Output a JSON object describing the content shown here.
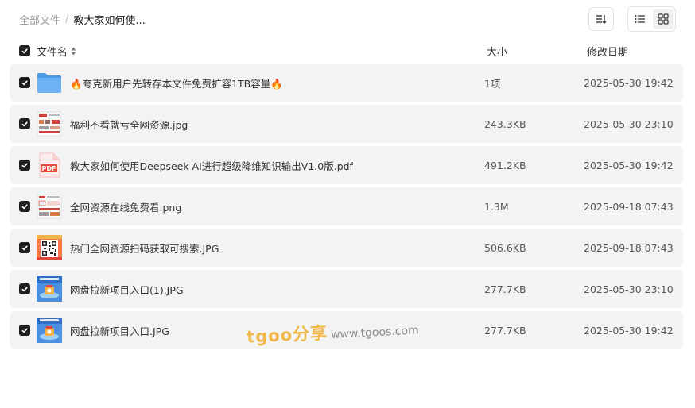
{
  "breadcrumb": {
    "root": "全部文件",
    "separator": "/",
    "current": "教大家如何使..."
  },
  "toolbar": {
    "sort_icon": "sort-icon",
    "list_view_icon": "list-view-icon",
    "grid_view_icon": "grid-view-icon",
    "active_view": "list"
  },
  "table": {
    "headers": {
      "name": "文件名",
      "size": "大小",
      "date": "修改日期"
    },
    "all_checked": true,
    "rows": [
      {
        "name": "🔥夸克新用户先转存本文件免费扩容1TB容量🔥",
        "size": "1项",
        "date": "2025-05-30 19:42",
        "type": "folder",
        "checked": true
      },
      {
        "name": "福利不看就亏全网资源.jpg",
        "size": "243.3KB",
        "date": "2025-05-30 23:10",
        "type": "image-doc",
        "checked": true
      },
      {
        "name": "教大家如何使用Deepseek AI进行超级降维知识输出V1.0版.pdf",
        "size": "491.2KB",
        "date": "2025-05-30 19:42",
        "type": "pdf",
        "checked": true
      },
      {
        "name": "全网资源在线免费看.png",
        "size": "1.3M",
        "date": "2025-09-18 07:43",
        "type": "image-doc",
        "checked": true
      },
      {
        "name": "热门全网资源扫码获取可搜索.JPG",
        "size": "506.6KB",
        "date": "2025-09-18 07:43",
        "type": "image-qr",
        "checked": true
      },
      {
        "name": "网盘拉新项目入口(1).JPG",
        "size": "277.7KB",
        "date": "2025-05-30 23:10",
        "type": "image-blue",
        "checked": true
      },
      {
        "name": "网盘拉新项目入口.JPG",
        "size": "277.7KB",
        "date": "2025-05-30 19:42",
        "type": "image-blue",
        "checked": true
      }
    ]
  },
  "watermark": {
    "brand": "tgoo分享",
    "url": "www.tgoos.com"
  },
  "colors": {
    "row_bg": "#f3f3f4",
    "folder": "#5aa7f0",
    "pdf": "#e8483c",
    "checkbox": "#1f1f1f",
    "watermark": "#f0b84a"
  }
}
